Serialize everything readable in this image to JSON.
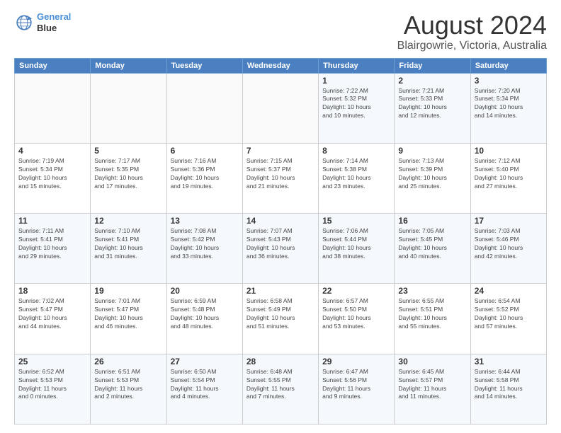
{
  "header": {
    "logo_line1": "General",
    "logo_line2": "Blue",
    "title": "August 2024",
    "subtitle": "Blairgowrie, Victoria, Australia"
  },
  "weekdays": [
    "Sunday",
    "Monday",
    "Tuesday",
    "Wednesday",
    "Thursday",
    "Friday",
    "Saturday"
  ],
  "weeks": [
    [
      {
        "day": "",
        "info": ""
      },
      {
        "day": "",
        "info": ""
      },
      {
        "day": "",
        "info": ""
      },
      {
        "day": "",
        "info": ""
      },
      {
        "day": "1",
        "info": "Sunrise: 7:22 AM\nSunset: 5:32 PM\nDaylight: 10 hours\nand 10 minutes."
      },
      {
        "day": "2",
        "info": "Sunrise: 7:21 AM\nSunset: 5:33 PM\nDaylight: 10 hours\nand 12 minutes."
      },
      {
        "day": "3",
        "info": "Sunrise: 7:20 AM\nSunset: 5:34 PM\nDaylight: 10 hours\nand 14 minutes."
      }
    ],
    [
      {
        "day": "4",
        "info": "Sunrise: 7:19 AM\nSunset: 5:34 PM\nDaylight: 10 hours\nand 15 minutes."
      },
      {
        "day": "5",
        "info": "Sunrise: 7:17 AM\nSunset: 5:35 PM\nDaylight: 10 hours\nand 17 minutes."
      },
      {
        "day": "6",
        "info": "Sunrise: 7:16 AM\nSunset: 5:36 PM\nDaylight: 10 hours\nand 19 minutes."
      },
      {
        "day": "7",
        "info": "Sunrise: 7:15 AM\nSunset: 5:37 PM\nDaylight: 10 hours\nand 21 minutes."
      },
      {
        "day": "8",
        "info": "Sunrise: 7:14 AM\nSunset: 5:38 PM\nDaylight: 10 hours\nand 23 minutes."
      },
      {
        "day": "9",
        "info": "Sunrise: 7:13 AM\nSunset: 5:39 PM\nDaylight: 10 hours\nand 25 minutes."
      },
      {
        "day": "10",
        "info": "Sunrise: 7:12 AM\nSunset: 5:40 PM\nDaylight: 10 hours\nand 27 minutes."
      }
    ],
    [
      {
        "day": "11",
        "info": "Sunrise: 7:11 AM\nSunset: 5:41 PM\nDaylight: 10 hours\nand 29 minutes."
      },
      {
        "day": "12",
        "info": "Sunrise: 7:10 AM\nSunset: 5:41 PM\nDaylight: 10 hours\nand 31 minutes."
      },
      {
        "day": "13",
        "info": "Sunrise: 7:08 AM\nSunset: 5:42 PM\nDaylight: 10 hours\nand 33 minutes."
      },
      {
        "day": "14",
        "info": "Sunrise: 7:07 AM\nSunset: 5:43 PM\nDaylight: 10 hours\nand 36 minutes."
      },
      {
        "day": "15",
        "info": "Sunrise: 7:06 AM\nSunset: 5:44 PM\nDaylight: 10 hours\nand 38 minutes."
      },
      {
        "day": "16",
        "info": "Sunrise: 7:05 AM\nSunset: 5:45 PM\nDaylight: 10 hours\nand 40 minutes."
      },
      {
        "day": "17",
        "info": "Sunrise: 7:03 AM\nSunset: 5:46 PM\nDaylight: 10 hours\nand 42 minutes."
      }
    ],
    [
      {
        "day": "18",
        "info": "Sunrise: 7:02 AM\nSunset: 5:47 PM\nDaylight: 10 hours\nand 44 minutes."
      },
      {
        "day": "19",
        "info": "Sunrise: 7:01 AM\nSunset: 5:47 PM\nDaylight: 10 hours\nand 46 minutes."
      },
      {
        "day": "20",
        "info": "Sunrise: 6:59 AM\nSunset: 5:48 PM\nDaylight: 10 hours\nand 48 minutes."
      },
      {
        "day": "21",
        "info": "Sunrise: 6:58 AM\nSunset: 5:49 PM\nDaylight: 10 hours\nand 51 minutes."
      },
      {
        "day": "22",
        "info": "Sunrise: 6:57 AM\nSunset: 5:50 PM\nDaylight: 10 hours\nand 53 minutes."
      },
      {
        "day": "23",
        "info": "Sunrise: 6:55 AM\nSunset: 5:51 PM\nDaylight: 10 hours\nand 55 minutes."
      },
      {
        "day": "24",
        "info": "Sunrise: 6:54 AM\nSunset: 5:52 PM\nDaylight: 10 hours\nand 57 minutes."
      }
    ],
    [
      {
        "day": "25",
        "info": "Sunrise: 6:52 AM\nSunset: 5:53 PM\nDaylight: 11 hours\nand 0 minutes."
      },
      {
        "day": "26",
        "info": "Sunrise: 6:51 AM\nSunset: 5:53 PM\nDaylight: 11 hours\nand 2 minutes."
      },
      {
        "day": "27",
        "info": "Sunrise: 6:50 AM\nSunset: 5:54 PM\nDaylight: 11 hours\nand 4 minutes."
      },
      {
        "day": "28",
        "info": "Sunrise: 6:48 AM\nSunset: 5:55 PM\nDaylight: 11 hours\nand 7 minutes."
      },
      {
        "day": "29",
        "info": "Sunrise: 6:47 AM\nSunset: 5:56 PM\nDaylight: 11 hours\nand 9 minutes."
      },
      {
        "day": "30",
        "info": "Sunrise: 6:45 AM\nSunset: 5:57 PM\nDaylight: 11 hours\nand 11 minutes."
      },
      {
        "day": "31",
        "info": "Sunrise: 6:44 AM\nSunset: 5:58 PM\nDaylight: 11 hours\nand 14 minutes."
      }
    ]
  ]
}
